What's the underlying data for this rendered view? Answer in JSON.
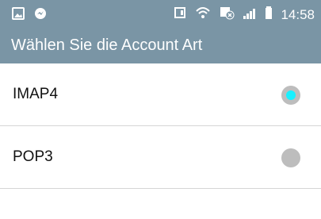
{
  "status_bar": {
    "time": "14:58",
    "icons_left": [
      "gallery-icon",
      "messenger-icon"
    ],
    "icons_right": [
      "nfc-icon",
      "wifi-icon",
      "notification-sync-icon",
      "signal-icon",
      "battery-icon"
    ]
  },
  "header": {
    "title": "Wählen Sie die Account Art"
  },
  "options": [
    {
      "label": "IMAP4",
      "selected": true
    },
    {
      "label": "POP3",
      "selected": false
    }
  ],
  "colors": {
    "header_bg": "#7a95a5",
    "radio_selected": "#18f0ff",
    "radio_unselected": "#bdbdbd"
  }
}
